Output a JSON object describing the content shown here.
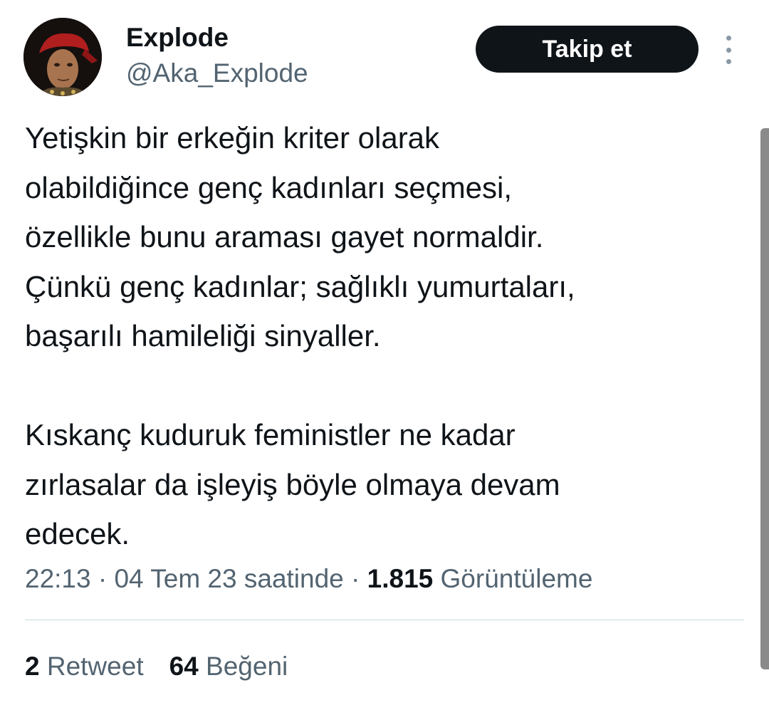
{
  "author": {
    "display_name": "Explode",
    "handle": "@Aka_Explode",
    "avatar_icon": "profile-avatar"
  },
  "follow_button_label": "Takip et",
  "more_icon": "more-vertical-icon",
  "tweet": {
    "paragraphs": [
      [
        "Yetişkin bir erkeğin kriter olarak",
        "olabildiğince genç kadınları seçmesi,",
        "özellikle bunu araması gayet normaldir.",
        "Çünkü genç kadınlar; sağlıklı yumurtaları,",
        "başarılı hamileliği sinyaller."
      ],
      [
        "Kıskanç kuduruk feministler ne kadar",
        "zırlasalar da işleyiş böyle olmaya devam",
        "edecek."
      ]
    ]
  },
  "meta": {
    "time": "22:13",
    "separator": "·",
    "date": "04 Tem 23 saatinde",
    "views_count": "1.815",
    "views_label": "Görüntüleme"
  },
  "stats": {
    "retweets_count": "2",
    "retweets_label": "Retweet",
    "likes_count": "64",
    "likes_label": "Beğeni"
  },
  "colors": {
    "text_primary": "#0f1419",
    "text_secondary": "#536471",
    "button_bg": "#0f1419",
    "divider": "#cfd9de"
  }
}
